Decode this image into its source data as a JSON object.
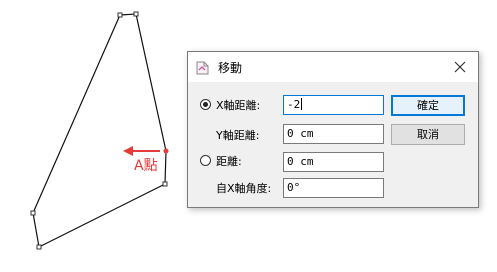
{
  "canvas": {
    "annotation_label": "A點",
    "accent_color": "#e53a3a"
  },
  "dialog": {
    "title": "移動",
    "title_icon": "move-document-icon",
    "close_icon": "close-icon",
    "x_distance": {
      "label": "X軸距離:",
      "value": "-2",
      "selected": true
    },
    "y_distance": {
      "label": "Y軸距離:",
      "value": "0 cm"
    },
    "distance": {
      "label": "距離:",
      "value": "0 cm",
      "selected": false
    },
    "angle": {
      "label": "自X軸角度:",
      "value": "0°"
    },
    "ok_label": "確定",
    "cancel_label": "取消"
  }
}
